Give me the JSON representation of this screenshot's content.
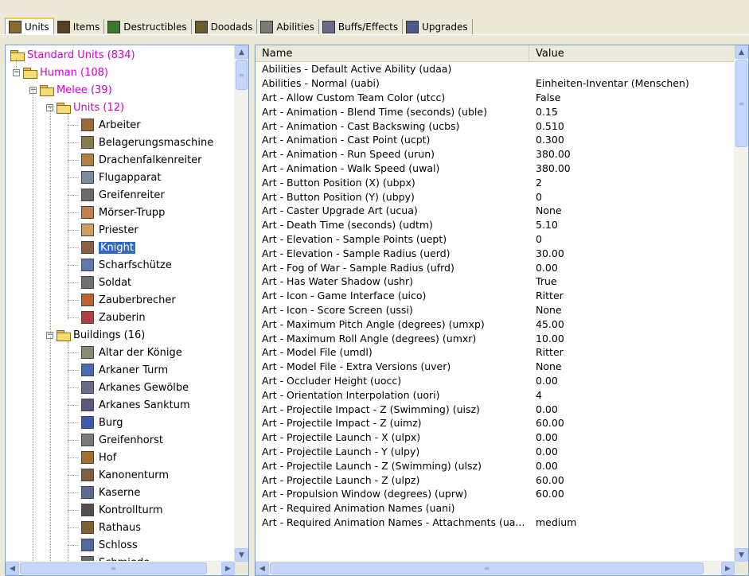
{
  "tabs": [
    {
      "label": "Units",
      "icon": "units-icon",
      "color": "#8a6a30",
      "active": true
    },
    {
      "label": "Items",
      "icon": "items-icon",
      "color": "#5a4020"
    },
    {
      "label": "Destructibles",
      "icon": "destructibles-icon",
      "color": "#3a7a2a"
    },
    {
      "label": "Doodads",
      "icon": "doodads-icon",
      "color": "#6a5a30"
    },
    {
      "label": "Abilities",
      "icon": "abilities-icon",
      "color": "#7a7a7a"
    },
    {
      "label": "Buffs/Effects",
      "icon": "buffs-effects-icon",
      "color": "#6a6a8a"
    },
    {
      "label": "Upgrades",
      "icon": "upgrades-icon",
      "color": "#4a5a8a"
    }
  ],
  "tree": {
    "root": {
      "label": "Standard Units (834)"
    },
    "race": {
      "label": "Human (108)"
    },
    "melee": {
      "label": "Melee (39)"
    },
    "units_folder": {
      "label": "Units (12)"
    },
    "units": [
      {
        "label": "Arbeiter",
        "color": "#9a6a3a"
      },
      {
        "label": "Belagerungsmaschine",
        "color": "#8a7a50"
      },
      {
        "label": "Drachenfalkenreiter",
        "color": "#b08040"
      },
      {
        "label": "Flugapparat",
        "color": "#7a8aa0"
      },
      {
        "label": "Greifenreiter",
        "color": "#6a6a6a"
      },
      {
        "label": "Mörser-Trupp",
        "color": "#c08050"
      },
      {
        "label": "Priester",
        "color": "#d0a060"
      },
      {
        "label": "Knight",
        "color": "#8a6040",
        "selected": true
      },
      {
        "label": "Scharfschütze",
        "color": "#5a7ab0"
      },
      {
        "label": "Soldat",
        "color": "#707070"
      },
      {
        "label": "Zauberbrecher",
        "color": "#c06030"
      },
      {
        "label": "Zauberin",
        "color": "#b04040"
      }
    ],
    "buildings_folder": {
      "label": "Buildings (16)"
    },
    "buildings": [
      {
        "label": "Altar der Könige",
        "color": "#8a8a70"
      },
      {
        "label": "Arkaner Turm",
        "color": "#4a6ab0"
      },
      {
        "label": "Arkanes Gewölbe",
        "color": "#6a6a8a"
      },
      {
        "label": "Arkanes Sanktum",
        "color": "#5a5a7a"
      },
      {
        "label": "Burg",
        "color": "#3a5ab0"
      },
      {
        "label": "Greifenhorst",
        "color": "#7a7a7a"
      },
      {
        "label": "Hof",
        "color": "#a07030"
      },
      {
        "label": "Kanonenturm",
        "color": "#806040"
      },
      {
        "label": "Kaserne",
        "color": "#5a6a90"
      },
      {
        "label": "Kontrollturm",
        "color": "#505050"
      },
      {
        "label": "Rathaus",
        "color": "#806030"
      },
      {
        "label": "Schloss",
        "color": "#4a6aa0"
      },
      {
        "label": "Schmiede",
        "color": "#6a6a6a"
      }
    ]
  },
  "table": {
    "columns": {
      "name": "Name",
      "value": "Value"
    },
    "rows": [
      {
        "name": "Abilities - Default Active Ability (udaa)",
        "value": ""
      },
      {
        "name": "Abilities - Normal (uabi)",
        "value": "Einheiten-Inventar (Menschen)"
      },
      {
        "name": "Art - Allow Custom Team Color (utcc)",
        "value": "False"
      },
      {
        "name": "Art - Animation - Blend Time (seconds) (uble)",
        "value": "0.15"
      },
      {
        "name": "Art - Animation - Cast Backswing (ucbs)",
        "value": "0.510"
      },
      {
        "name": "Art - Animation - Cast Point (ucpt)",
        "value": "0.300"
      },
      {
        "name": "Art - Animation - Run Speed (urun)",
        "value": "380.00"
      },
      {
        "name": "Art - Animation - Walk Speed (uwal)",
        "value": "380.00"
      },
      {
        "name": "Art - Button Position (X) (ubpx)",
        "value": "2"
      },
      {
        "name": "Art - Button Position (Y) (ubpy)",
        "value": "0"
      },
      {
        "name": "Art - Caster Upgrade Art (ucua)",
        "value": "None"
      },
      {
        "name": "Art - Death Time (seconds) (udtm)",
        "value": "5.10"
      },
      {
        "name": "Art - Elevation - Sample Points (uept)",
        "value": "0"
      },
      {
        "name": "Art - Elevation - Sample Radius (uerd)",
        "value": "30.00"
      },
      {
        "name": "Art - Fog of War - Sample Radius (ufrd)",
        "value": "0.00"
      },
      {
        "name": "Art - Has Water Shadow (ushr)",
        "value": "True"
      },
      {
        "name": "Art - Icon - Game Interface (uico)",
        "value": "Ritter"
      },
      {
        "name": "Art - Icon - Score Screen (ussi)",
        "value": "None"
      },
      {
        "name": "Art - Maximum Pitch Angle (degrees) (umxp)",
        "value": "45.00"
      },
      {
        "name": "Art - Maximum Roll Angle (degrees) (umxr)",
        "value": "10.00"
      },
      {
        "name": "Art - Model File (umdl)",
        "value": "Ritter"
      },
      {
        "name": "Art - Model File - Extra Versions (uver)",
        "value": "None"
      },
      {
        "name": "Art - Occluder Height (uocc)",
        "value": "0.00"
      },
      {
        "name": "Art - Orientation Interpolation (uori)",
        "value": "4"
      },
      {
        "name": "Art - Projectile Impact - Z (Swimming) (uisz)",
        "value": "0.00"
      },
      {
        "name": "Art - Projectile Impact - Z (uimz)",
        "value": "60.00"
      },
      {
        "name": "Art - Projectile Launch - X (ulpx)",
        "value": "0.00"
      },
      {
        "name": "Art - Projectile Launch - Y (ulpy)",
        "value": "0.00"
      },
      {
        "name": "Art - Projectile Launch - Z (Swimming) (ulsz)",
        "value": "0.00"
      },
      {
        "name": "Art - Projectile Launch - Z (ulpz)",
        "value": "60.00"
      },
      {
        "name": "Art - Propulsion Window (degrees) (uprw)",
        "value": "60.00"
      },
      {
        "name": "Art - Required Animation Names (uani)",
        "value": ""
      },
      {
        "name": "Art - Required Animation Names - Attachments (ua...",
        "value": "medium"
      }
    ]
  },
  "scrollbar_glyphs": {
    "up": "▲",
    "down": "▼",
    "left": "◀",
    "right": "▶",
    "grip": "≡"
  }
}
